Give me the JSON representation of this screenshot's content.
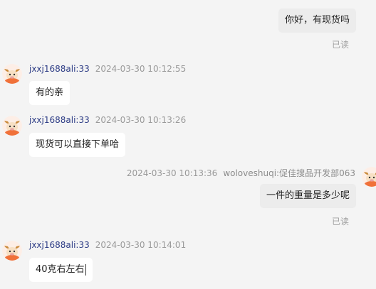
{
  "messages": [
    {
      "text": "你好，有现货吗",
      "status": "已读"
    },
    {
      "sender": "jxxj1688ali:33",
      "time": "2024-03-30 10:12:55",
      "text": "有的亲"
    },
    {
      "sender": "jxxj1688ali:33",
      "time": "2024-03-30 10:13:26",
      "text": "现货可以直接下单哈"
    },
    {
      "sender": "woloveshuqi:促佳搜品开发部063",
      "time": "2024-03-30 10:13:36",
      "text": "一件的重量是多少呢",
      "status": "已读"
    },
    {
      "sender": "jxxj1688ali:33",
      "time": "2024-03-30 10:14:01",
      "text": "40克右左右"
    }
  ],
  "avatar_icon": "ox-mascot-icon"
}
